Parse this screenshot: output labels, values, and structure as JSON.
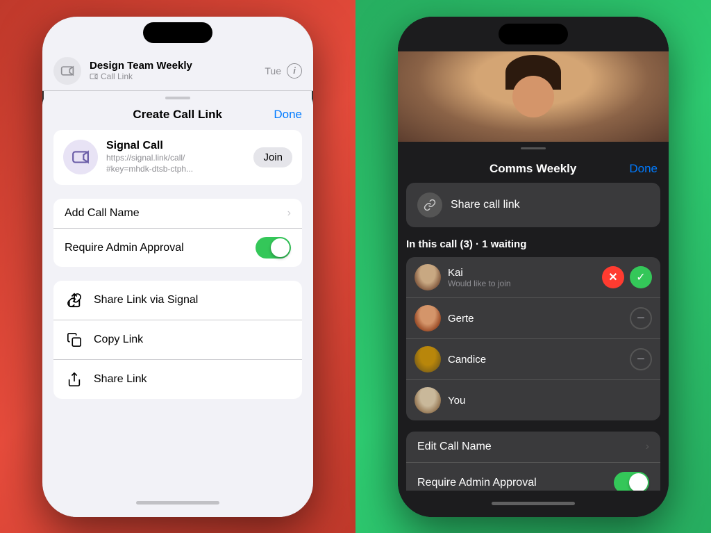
{
  "left_phone": {
    "header": {
      "title": "Design Team Weekly",
      "subtitle": "Call Link",
      "date": "Tue"
    },
    "sheet": {
      "title": "Create Call Link",
      "done_label": "Done"
    },
    "call_card": {
      "name": "Signal Call",
      "url": "https://signal.link/call/\n#key=mhdk-dtsb-ctph...",
      "join_label": "Join"
    },
    "settings": {
      "add_call_name_label": "Add Call Name",
      "require_admin_label": "Require Admin Approval"
    },
    "share": {
      "via_signal_label": "Share Link via Signal",
      "copy_link_label": "Copy Link",
      "share_link_label": "Share Link"
    }
  },
  "right_phone": {
    "header": {
      "title": "Comms Weekly",
      "done_label": "Done"
    },
    "share_call_link_label": "Share call link",
    "in_call_status": "In this call (3) · 1 waiting",
    "participants": [
      {
        "name": "Kai",
        "status": "Would like to join",
        "has_actions": true,
        "avatar_class": "avatar-kai"
      },
      {
        "name": "Gerte",
        "status": "",
        "has_actions": false,
        "avatar_class": "avatar-gerte"
      },
      {
        "name": "Candice",
        "status": "",
        "has_actions": false,
        "avatar_class": "avatar-candice"
      },
      {
        "name": "You",
        "status": "",
        "has_actions": false,
        "avatar_class": "avatar-you"
      }
    ],
    "settings": {
      "edit_call_name_label": "Edit Call Name",
      "require_admin_label": "Require Admin Approval"
    }
  },
  "icons": {
    "video_camera": "📹",
    "link_chain": "🔗",
    "share_signal": "↗",
    "copy": "⎘",
    "share": "⬆"
  }
}
